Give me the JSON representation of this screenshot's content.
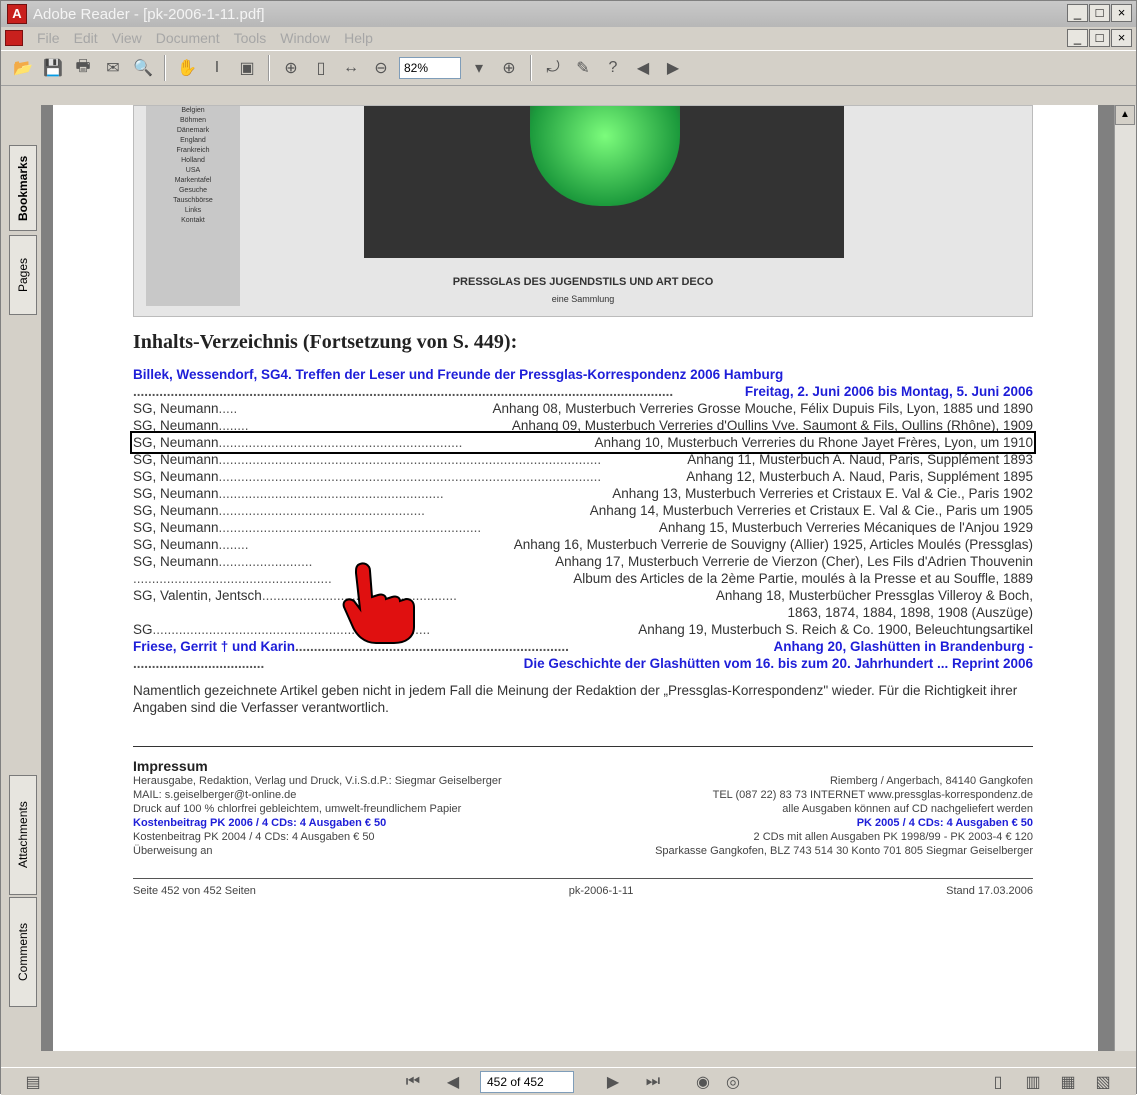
{
  "window": {
    "title": "Adobe Reader - [pk-2006-1-11.pdf]",
    "minimize": "_",
    "maximize": "□",
    "close": "×",
    "restore": "ð"
  },
  "menu": [
    "File",
    "Edit",
    "View",
    "Document",
    "Tools",
    "Window",
    "Help"
  ],
  "toolbar": {
    "zoom": "82%"
  },
  "nav_tabs": {
    "bookmarks": "Bookmarks",
    "pages": "Pages",
    "attachments": "Attachments",
    "comments": "Comments"
  },
  "banner": {
    "nav_items": [
      "Belgien",
      "Böhmen",
      "Dänemark",
      "England",
      "Frankreich",
      "Holland",
      "USA",
      "Markentafel",
      "Gesuche",
      "Tauschbörse",
      "Links",
      "Kontakt"
    ],
    "title": "PRESSGLAS DES JUGENDSTILS UND ART DECO",
    "subtitle": "eine Sammlung"
  },
  "document": {
    "heading": "Inhalts-Verzeichnis (Fortsetzung von S. 449):",
    "entries": [
      {
        "left": "Billek, Wessendorf, SG4. Treffen der Leser und Freunde der Pressglas-Korrespondenz 2006 Hamburg",
        "dots": "",
        "right": "",
        "style": "blue"
      },
      {
        "left": "",
        "dots": "................................................................................................................................................",
        "right": "Freitag, 2. Juni 2006 bis Montag, 5. Juni 2006",
        "style": "blue"
      },
      {
        "left": "SG, Neumann",
        "dots": " ..... ",
        "right": "Anhang 08, Musterbuch Verreries Grosse Mouche, Félix Dupuis Fils, Lyon, 1885 und 1890",
        "style": ""
      },
      {
        "left": "SG, Neumann",
        "dots": " ........ ",
        "right": "Anhang 09, Musterbuch Verreries d'Oullins Vve. Saumont & Fils, Oullins (Rhône), 1909",
        "style": ""
      },
      {
        "left": "SG, Neumann",
        "dots": " ................................................................. ",
        "right": "Anhang 10, Musterbuch Verreries du Rhone Jayet Frères, Lyon, um 1910",
        "style": "hl"
      },
      {
        "left": "SG, Neumann",
        "dots": " ...................................................................................................... ",
        "right": "Anhang 11, Musterbuch A. Naud, Paris, Supplément 1893",
        "style": ""
      },
      {
        "left": "SG, Neumann",
        "dots": " ...................................................................................................... ",
        "right": "Anhang 12, Musterbuch A. Naud, Paris, Supplément 1895",
        "style": ""
      },
      {
        "left": "SG, Neumann",
        "dots": " ............................................................ ",
        "right": "Anhang 13, Musterbuch Verreries et Cristaux E. Val & Cie., Paris 1902",
        "style": ""
      },
      {
        "left": "SG, Neumann",
        "dots": " ....................................................... ",
        "right": "Anhang 14, Musterbuch Verreries et Cristaux E. Val & Cie., Paris um 1905",
        "style": ""
      },
      {
        "left": "SG, Neumann",
        "dots": " ...................................................................... ",
        "right": "Anhang 15, Musterbuch Verreries Mécaniques de l'Anjou 1929",
        "style": ""
      },
      {
        "left": "SG, Neumann",
        "dots": " ........ ",
        "right": "Anhang 16, Musterbuch Verrerie de Souvigny (Allier) 1925, Articles Moulés (Pressglas)",
        "style": ""
      },
      {
        "left": "SG, Neumann",
        "dots": " ......................... ",
        "right": "Anhang 17, Musterbuch Verrerie de Vierzon (Cher), Les Fils d'Adrien Thouvenin",
        "style": ""
      },
      {
        "left": "",
        "dots": "..................................................... ",
        "right": "Album des Articles de la 2ème Partie, moulés à la Presse et au Souffle, 1889",
        "style": ""
      },
      {
        "left": "SG, Valentin, Jentsch",
        "dots": " .................................................... ",
        "right": "Anhang 18, Musterbücher Pressglas Villeroy & Boch,",
        "style": ""
      },
      {
        "left": "",
        "dots": "",
        "right": "1863, 1874, 1884, 1898, 1908 (Auszüge)",
        "style": "rightonly"
      },
      {
        "left": "SG",
        "dots": " .......................................................................... ",
        "right": "Anhang 19, Musterbuch S. Reich & Co. 1900, Beleuchtungsartikel",
        "style": ""
      },
      {
        "left": "Friese, Gerrit † und Karin",
        "dots": " ......................................................................... ",
        "right": "Anhang 20, Glashütten in Brandenburg -",
        "style": "blue"
      },
      {
        "left": "",
        "dots": "................................... ",
        "right": "Die Geschichte der Glashütten vom 16. bis zum 20. Jahrhundert ... Reprint 2006",
        "style": "blue"
      }
    ],
    "note": "Namentlich gezeichnete Artikel geben nicht in jedem Fall die Meinung der Redaktion der „Pressglas-Korrespondenz\" wieder. Für die Richtigkeit ihrer Angaben sind die Verfasser verantwortlich.",
    "impressum_title": "Impressum",
    "impressum": [
      {
        "a": "Herausgabe, Redaktion, Verlag und Druck, V.i.S.d.P.: Siegmar Geiselberger",
        "b": "Riemberg / Angerbach, 84140 Gangkofen",
        "style": ""
      },
      {
        "a": "MAIL: s.geiselberger@t-online.de",
        "b": "TEL (087 22) 83 73      INTERNET www.pressglas-korrespondenz.de",
        "style": ""
      },
      {
        "a": "Druck auf 100 % chlorfrei gebleichtem, umwelt-freundlichem Papier",
        "b": "alle Ausgaben können auf CD nachgeliefert werden",
        "style": ""
      },
      {
        "a": "Kostenbeitrag PK 2006 / 4 CDs: 4 Ausgaben € 50",
        "b": "PK 2005 / 4 CDs: 4 Ausgaben € 50",
        "style": "b"
      },
      {
        "a": "Kostenbeitrag PK 2004 / 4 CDs: 4 Ausgaben € 50",
        "b": "2 CDs mit allen Ausgaben PK 1998/99 - PK 2003-4 € 120",
        "style": ""
      },
      {
        "a": "Überweisung an",
        "b": "Sparkasse Gangkofen, BLZ 743 514 30     Konto 701 805 Siegmar Geiselberger",
        "style": ""
      }
    ],
    "footer": {
      "left": "Seite 452 von 452 Seiten",
      "center": "pk-2006-1-11",
      "right": "Stand 17.03.2006"
    }
  },
  "status": {
    "page": "452 of 452"
  }
}
